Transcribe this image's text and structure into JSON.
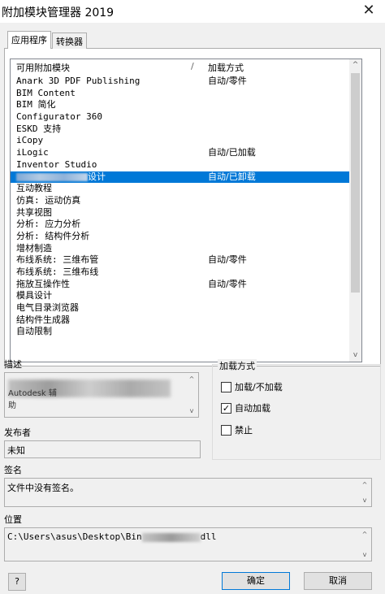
{
  "window": {
    "title": "附加模块管理器 2019",
    "close_glyph": "✕"
  },
  "tabs": [
    {
      "label": "应用程序"
    },
    {
      "label": "转换器"
    }
  ],
  "list": {
    "header_name": "可用附加模块",
    "header_sep": "/",
    "header_load": "加载方式",
    "rows": [
      {
        "name": "Anark 3D PDF Publishing",
        "load": "自动/零件"
      },
      {
        "name": "BIM Content",
        "load": ""
      },
      {
        "name": "BIM 简化",
        "load": ""
      },
      {
        "name": "Configurator 360",
        "load": ""
      },
      {
        "name": "ESKD 支持",
        "load": ""
      },
      {
        "name": "iCopy",
        "load": ""
      },
      {
        "name": "iLogic",
        "load": "自动/已加载"
      },
      {
        "name": "Inventor Studio",
        "load": ""
      },
      {
        "name": "设计",
        "load": "自动/已卸载"
      },
      {
        "name": "互动教程",
        "load": ""
      },
      {
        "name": "仿真: 运动仿真",
        "load": ""
      },
      {
        "name": "共享视图",
        "load": ""
      },
      {
        "name": "分析: 应力分析",
        "load": ""
      },
      {
        "name": "分析: 结构件分析",
        "load": ""
      },
      {
        "name": "增材制造",
        "load": ""
      },
      {
        "name": "布线系统: 三维布管",
        "load": "自动/零件"
      },
      {
        "name": "布线系统: 三维布线",
        "load": ""
      },
      {
        "name": "拖放互操作性",
        "load": "自动/零件"
      },
      {
        "name": "模具设计",
        "load": ""
      },
      {
        "name": "电气目录浏览器",
        "load": ""
      },
      {
        "name": "结构件生成器",
        "load": ""
      },
      {
        "name": "自动限制",
        "load": ""
      }
    ],
    "selected_index": 8,
    "scroll_up_glyph": "^",
    "scroll_down_glyph": "v"
  },
  "description": {
    "label": "描述",
    "text": "Autodesk 辅",
    "text_prefix": "助"
  },
  "load_method": {
    "label": "加载方式",
    "options": [
      {
        "label": "加载/不加载",
        "checked": false
      },
      {
        "label": "自动加载",
        "checked": true
      },
      {
        "label": "禁止",
        "checked": false
      }
    ]
  },
  "publisher": {
    "label": "发布者",
    "value": "未知"
  },
  "signature": {
    "label": "签名",
    "value": "文件中没有签名。"
  },
  "location": {
    "label": "位置",
    "prefix": "C:\\Users\\asus\\Desktop\\Bin",
    "suffix": "dll"
  },
  "buttons": {
    "help": "?",
    "ok": "确定",
    "cancel": "取消"
  }
}
